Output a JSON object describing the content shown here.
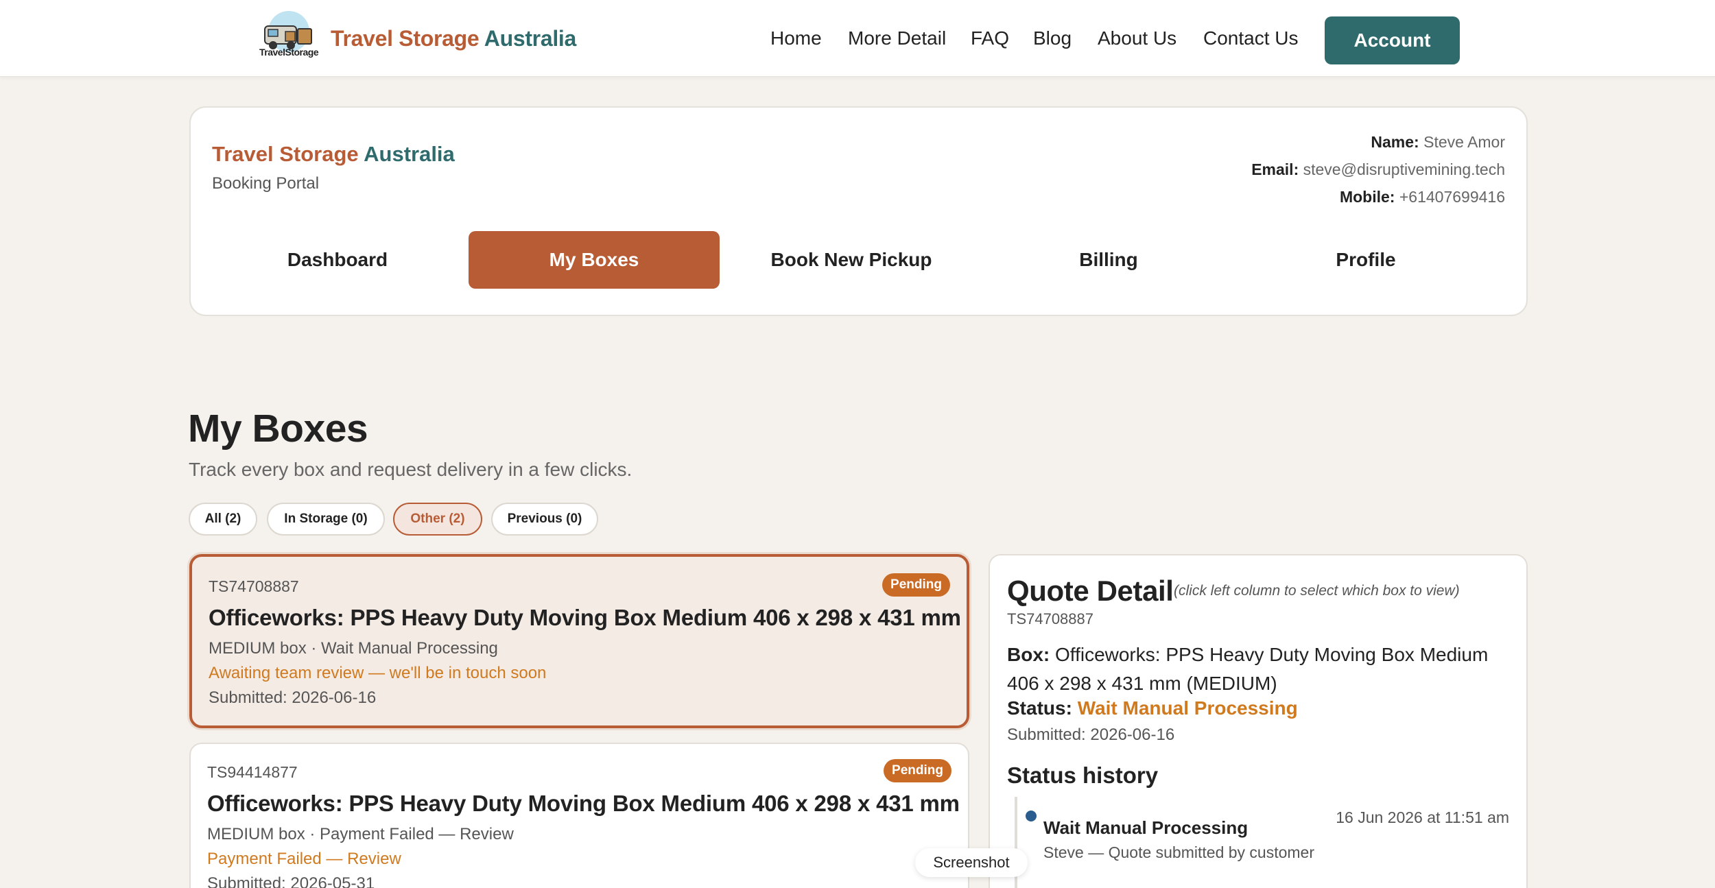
{
  "header": {
    "logo_text": "TravelStorage",
    "brand_part1": "Travel Storage",
    "brand_part2": "Australia",
    "nav": {
      "home": "Home",
      "more_detail": "More Detail",
      "faq": "FAQ",
      "blog": "Blog",
      "about": "About Us",
      "contact": "Contact Us"
    },
    "account_label": "Account"
  },
  "portal": {
    "brand_part1": "Travel Storage",
    "brand_part2": "Australia",
    "subtitle": "Booking Portal",
    "user": {
      "name_label": "Name:",
      "name": "Steve Amor",
      "email_label": "Email:",
      "email": "steve@disruptivemining.tech",
      "mobile_label": "Mobile:",
      "mobile": "+61407699416"
    },
    "tabs": [
      "Dashboard",
      "My Boxes",
      "Book New Pickup",
      "Billing",
      "Profile"
    ],
    "active_tab": "My Boxes"
  },
  "page": {
    "title": "My Boxes",
    "subtitle": "Track every box and request delivery in a few clicks."
  },
  "filters": [
    {
      "label": "All (2)",
      "active": false
    },
    {
      "label": "In Storage (0)",
      "active": false
    },
    {
      "label": "Other (2)",
      "active": true
    },
    {
      "label": "Previous (0)",
      "active": false
    }
  ],
  "boxes": [
    {
      "id": "TS74708887",
      "title": "Officeworks: PPS Heavy Duty Moving Box Medium 406 x 298 x 431 mm",
      "meta": "MEDIUM box · Wait Manual Processing",
      "note": "Awaiting team review — we'll be in touch soon",
      "submitted": "Submitted: 2026-06-16",
      "badge": "Pending",
      "selected": true
    },
    {
      "id": "TS94414877",
      "title": "Officeworks: PPS Heavy Duty Moving Box Medium 406 x 298 x 431 mm",
      "meta": "MEDIUM box · Payment Failed — Review",
      "note": "Payment Failed — Review",
      "submitted": "Submitted: 2026-05-31",
      "badge": "Pending",
      "selected": false
    }
  ],
  "quote": {
    "title": "Quote Detail",
    "hint": "(click left column to select which box to view)",
    "id": "TS74708887",
    "box_label": "Box:",
    "box_value": "Officeworks: PPS Heavy Duty Moving Box Medium 406 x 298 x 431 mm (MEDIUM)",
    "status_label": "Status:",
    "status_value": "Wait Manual Processing",
    "submitted": "Submitted: 2026-06-16",
    "history_title": "Status history",
    "history": [
      {
        "status": "Wait Manual Processing",
        "who": "Steve — Quote submitted by customer",
        "date": "16 Jun 2026 at 11:51 am"
      }
    ]
  },
  "overlay": {
    "screenshot_label": "Screenshot"
  },
  "colors": {
    "accent": "#b85c36",
    "brand_teal": "#2f6b6c",
    "pending": "#c96a25",
    "warning_text": "#d07a1f",
    "background": "#f5f2ed"
  }
}
